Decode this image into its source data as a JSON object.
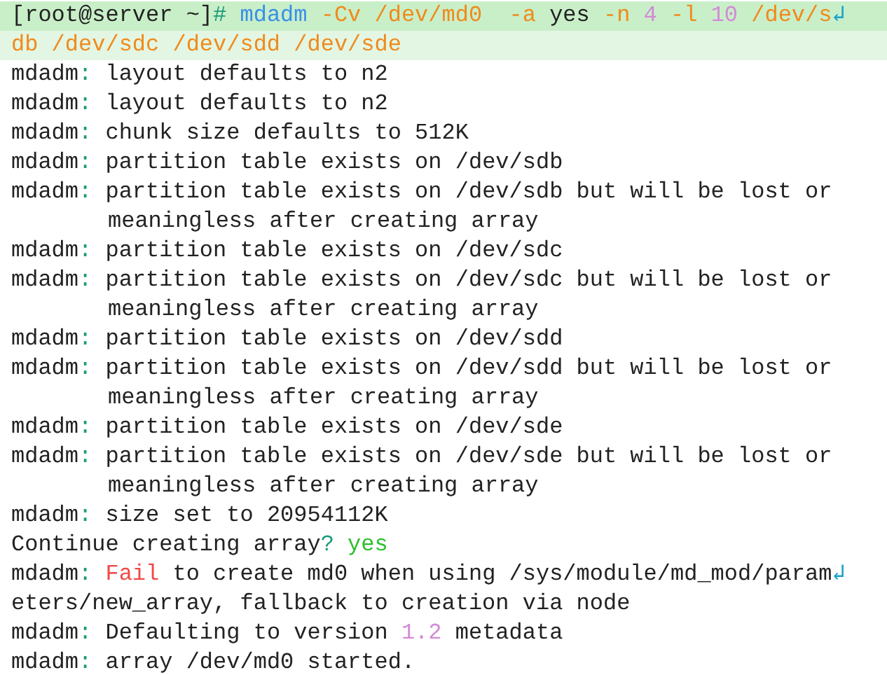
{
  "terminal": {
    "lines": [
      {
        "selected": true,
        "cursor": true,
        "indent": false,
        "segments": [
          {
            "kind": "plain",
            "text": "[root@server ~]"
          },
          {
            "kind": "punct",
            "text": "# "
          },
          {
            "kind": "command",
            "text": "mdadm "
          },
          {
            "kind": "option",
            "text": "-Cv /dev/md0  -a "
          },
          {
            "kind": "plain",
            "text": "yes "
          },
          {
            "kind": "option",
            "text": "-n "
          },
          {
            "kind": "number",
            "text": "4 "
          },
          {
            "kind": "option",
            "text": "-l "
          },
          {
            "kind": "number",
            "text": "10 "
          },
          {
            "kind": "option",
            "text": "/dev/s"
          },
          {
            "kind": "wrap",
            "text": "↲"
          }
        ]
      },
      {
        "selected": true,
        "cursor": false,
        "indent": false,
        "segments": [
          {
            "kind": "option",
            "text": "db /dev/sdc /dev/sdd /dev/sde"
          }
        ]
      },
      {
        "selected": false,
        "cursor": false,
        "indent": false,
        "segments": [
          {
            "kind": "plain",
            "text": "mdadm"
          },
          {
            "kind": "punct",
            "text": ": "
          },
          {
            "kind": "plain",
            "text": "layout defaults to n2"
          }
        ]
      },
      {
        "selected": false,
        "cursor": false,
        "indent": false,
        "segments": [
          {
            "kind": "plain",
            "text": "mdadm"
          },
          {
            "kind": "punct",
            "text": ": "
          },
          {
            "kind": "plain",
            "text": "layout defaults to n2"
          }
        ]
      },
      {
        "selected": false,
        "cursor": false,
        "indent": false,
        "segments": [
          {
            "kind": "plain",
            "text": "mdadm"
          },
          {
            "kind": "punct",
            "text": ": "
          },
          {
            "kind": "plain",
            "text": "chunk size defaults to 512K"
          }
        ]
      },
      {
        "selected": false,
        "cursor": false,
        "indent": false,
        "segments": [
          {
            "kind": "plain",
            "text": "mdadm"
          },
          {
            "kind": "punct",
            "text": ": "
          },
          {
            "kind": "plain",
            "text": "partition table exists on /dev/sdb"
          }
        ]
      },
      {
        "selected": false,
        "cursor": false,
        "indent": false,
        "segments": [
          {
            "kind": "plain",
            "text": "mdadm"
          },
          {
            "kind": "punct",
            "text": ": "
          },
          {
            "kind": "plain",
            "text": "partition table exists on /dev/sdb but will be lost or"
          }
        ]
      },
      {
        "selected": false,
        "cursor": false,
        "indent": true,
        "segments": [
          {
            "kind": "plain",
            "text": "meaningless after creating array"
          }
        ]
      },
      {
        "selected": false,
        "cursor": false,
        "indent": false,
        "segments": [
          {
            "kind": "plain",
            "text": "mdadm"
          },
          {
            "kind": "punct",
            "text": ": "
          },
          {
            "kind": "plain",
            "text": "partition table exists on /dev/sdc"
          }
        ]
      },
      {
        "selected": false,
        "cursor": false,
        "indent": false,
        "segments": [
          {
            "kind": "plain",
            "text": "mdadm"
          },
          {
            "kind": "punct",
            "text": ": "
          },
          {
            "kind": "plain",
            "text": "partition table exists on /dev/sdc but will be lost or"
          }
        ]
      },
      {
        "selected": false,
        "cursor": false,
        "indent": true,
        "segments": [
          {
            "kind": "plain",
            "text": "meaningless after creating array"
          }
        ]
      },
      {
        "selected": false,
        "cursor": false,
        "indent": false,
        "segments": [
          {
            "kind": "plain",
            "text": "mdadm"
          },
          {
            "kind": "punct",
            "text": ": "
          },
          {
            "kind": "plain",
            "text": "partition table exists on /dev/sdd"
          }
        ]
      },
      {
        "selected": false,
        "cursor": false,
        "indent": false,
        "segments": [
          {
            "kind": "plain",
            "text": "mdadm"
          },
          {
            "kind": "punct",
            "text": ": "
          },
          {
            "kind": "plain",
            "text": "partition table exists on /dev/sdd but will be lost or"
          }
        ]
      },
      {
        "selected": false,
        "cursor": false,
        "indent": true,
        "segments": [
          {
            "kind": "plain",
            "text": "meaningless after creating array"
          }
        ]
      },
      {
        "selected": false,
        "cursor": false,
        "indent": false,
        "segments": [
          {
            "kind": "plain",
            "text": "mdadm"
          },
          {
            "kind": "punct",
            "text": ": "
          },
          {
            "kind": "plain",
            "text": "partition table exists on /dev/sde"
          }
        ]
      },
      {
        "selected": false,
        "cursor": false,
        "indent": false,
        "segments": [
          {
            "kind": "plain",
            "text": "mdadm"
          },
          {
            "kind": "punct",
            "text": ": "
          },
          {
            "kind": "plain",
            "text": "partition table exists on /dev/sde but will be lost or"
          }
        ]
      },
      {
        "selected": false,
        "cursor": false,
        "indent": true,
        "segments": [
          {
            "kind": "plain",
            "text": "meaningless after creating array"
          }
        ]
      },
      {
        "selected": false,
        "cursor": false,
        "indent": false,
        "segments": [
          {
            "kind": "plain",
            "text": "mdadm"
          },
          {
            "kind": "punct",
            "text": ": "
          },
          {
            "kind": "plain",
            "text": "size set to 20954112K"
          }
        ]
      },
      {
        "selected": false,
        "cursor": false,
        "indent": false,
        "segments": [
          {
            "kind": "plain",
            "text": "Continue creating array"
          },
          {
            "kind": "punct",
            "text": "? "
          },
          {
            "kind": "answer",
            "text": "yes"
          }
        ]
      },
      {
        "selected": false,
        "cursor": false,
        "indent": false,
        "segments": [
          {
            "kind": "plain",
            "text": "mdadm"
          },
          {
            "kind": "punct",
            "text": ": "
          },
          {
            "kind": "error",
            "text": "Fail"
          },
          {
            "kind": "plain",
            "text": " to create md0 when using /sys/module/md_mod/param"
          },
          {
            "kind": "wrap",
            "text": "↲"
          }
        ]
      },
      {
        "selected": false,
        "cursor": false,
        "indent": false,
        "segments": [
          {
            "kind": "plain",
            "text": "eters/new_array, fallback to creation via node"
          }
        ]
      },
      {
        "selected": false,
        "cursor": false,
        "indent": false,
        "segments": [
          {
            "kind": "plain",
            "text": "mdadm"
          },
          {
            "kind": "punct",
            "text": ": "
          },
          {
            "kind": "plain",
            "text": "Defaulting to version "
          },
          {
            "kind": "number",
            "text": "1.2"
          },
          {
            "kind": "plain",
            "text": " metadata"
          }
        ]
      },
      {
        "selected": false,
        "cursor": false,
        "indent": false,
        "segments": [
          {
            "kind": "plain",
            "text": "mdadm"
          },
          {
            "kind": "punct",
            "text": ": "
          },
          {
            "kind": "plain",
            "text": "array /dev/md0 started."
          }
        ]
      }
    ]
  }
}
